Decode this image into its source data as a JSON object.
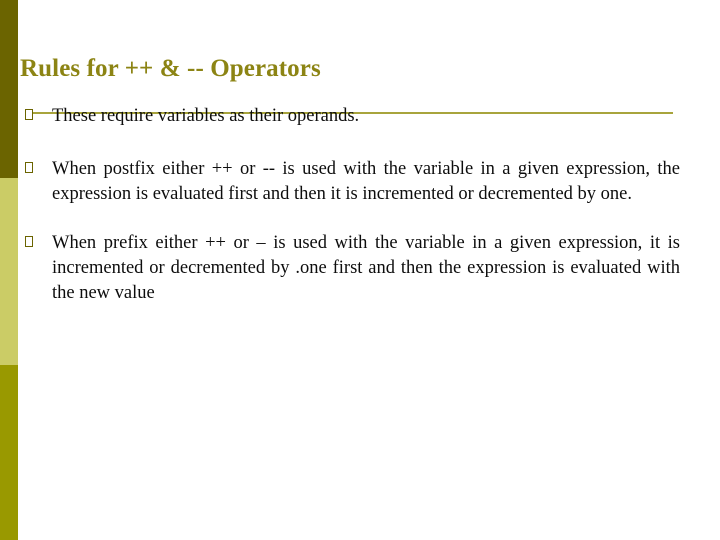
{
  "slide": {
    "title": "Rules for ++ & -- Operators",
    "background_color": "#ffffff",
    "title_color": "#8c8414",
    "rule_color": "#a8a43c",
    "sidebar": {
      "bands": [
        {
          "name": "band-top",
          "color": "#6b6400"
        },
        {
          "name": "band-middle",
          "color": "#cbcc66"
        },
        {
          "name": "band-bottom",
          "color": "#999900"
        }
      ]
    },
    "bullet_marker": "box-glyph",
    "bullets": [
      {
        "text": "These require variables as their operands."
      },
      {
        "text": "When postfix either ++ or -- is used with the variable in a given expression, the expression is evaluated first and then it is incremented or decremented by one."
      },
      {
        "text": "When prefix either ++ or – is used with the variable in a given expression, it is incremented or decremented by .one first and then  the expression is evaluated with the new value"
      }
    ]
  }
}
